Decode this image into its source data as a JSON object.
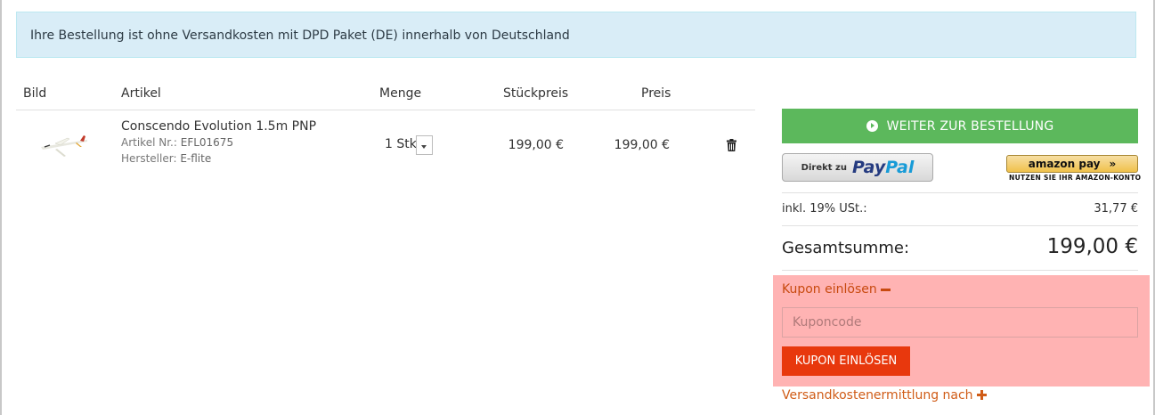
{
  "banner": {
    "text": "Ihre Bestellung ist ohne Versandkosten mit DPD Paket (DE) innerhalb von Deutschland"
  },
  "table": {
    "headers": {
      "image": "Bild",
      "article": "Artikel",
      "quantity": "Menge",
      "unit_price": "Stückpreis",
      "price": "Preis"
    },
    "rows": [
      {
        "name": "Conscendo Evolution 1.5m PNP",
        "article_no_label": "Artikel Nr.:",
        "article_no": "EFL01675",
        "manufacturer_label": "Hersteller:",
        "manufacturer": "E-flite",
        "quantity": "1 Stk",
        "unit_price": "199,00 €",
        "price": "199,00 €"
      }
    ]
  },
  "summary": {
    "checkout_label": "WEITER ZUR BESTELLUNG",
    "paypal_prefix": "Direkt zu",
    "paypal_brand_1": "Pay",
    "paypal_brand_2": "Pal",
    "amazon_label": "amazon pay",
    "amazon_sub": "NUTZEN SIE IHR AMAZON-KONTO",
    "tax_label": "inkl. 19% USt.:",
    "tax_value": "31,77 €",
    "total_label": "Gesamtsumme:",
    "total_value": "199,00 €"
  },
  "coupon": {
    "toggle_label": "Kupon einlösen",
    "placeholder": "Kuponcode",
    "button_label": "KUPON EINLÖSEN"
  },
  "shipping": {
    "link_label": "Versandkostenermittlung nach"
  },
  "colors": {
    "info_bg": "#d9edf7",
    "checkout_green": "#5cb85c",
    "coupon_highlight": "#ffb3b3",
    "coupon_button": "#e8380d",
    "link_orange": "#d05c17"
  }
}
